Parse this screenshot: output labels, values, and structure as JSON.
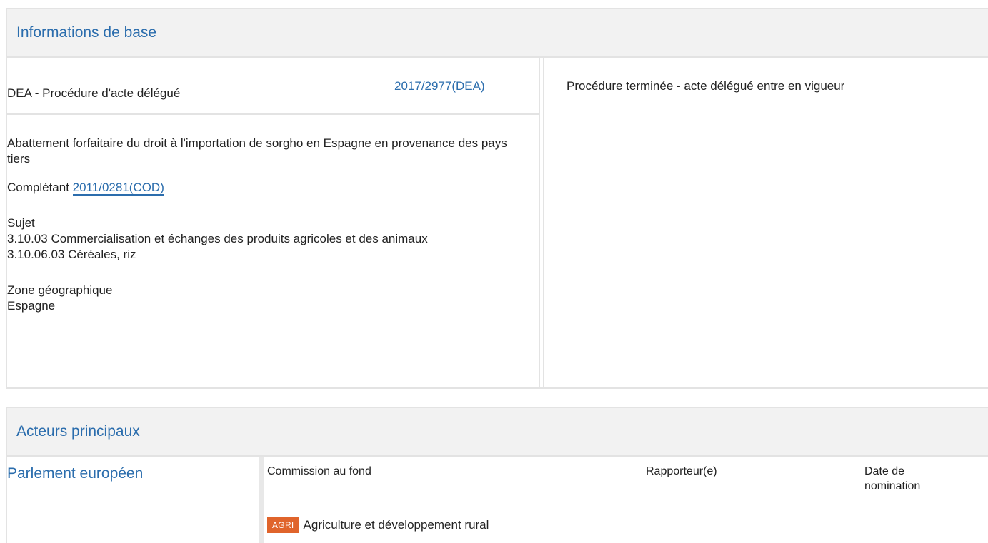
{
  "basic_info": {
    "title": "Informations de base",
    "procedure_type": "DEA - Procédure d'acte délégué",
    "procedure_ref": "2017/2977(DEA)",
    "status": "Procédure terminée - acte délégué entre en vigueur",
    "description": "Abattement forfaitaire du droit à l'importation de sorgho en Espagne en provenance des pays tiers",
    "completing_label": "Complétant",
    "completing_ref": "2011/0281(COD)",
    "subject_label": "Sujet",
    "subjects": [
      "3.10.03 Commercialisation et échanges des produits agricoles et des animaux",
      "3.10.06.03 Céréales, riz"
    ],
    "geo_label": "Zone géographique",
    "geo_value": "Espagne"
  },
  "actors": {
    "title": "Acteurs principaux",
    "institution": "Parlement européen",
    "col_committee": "Commission au fond",
    "col_rapporteur": "Rapporteur(e)",
    "col_date_line1": "Date de",
    "col_date_line2": "nomination",
    "committee_badge": "AGRI",
    "committee_name": "Agriculture et développement rural"
  },
  "colors": {
    "link": "#2b6dad",
    "badge": "#e0642b",
    "header_bg": "#f2f2f2",
    "border": "#e3e3e3"
  }
}
